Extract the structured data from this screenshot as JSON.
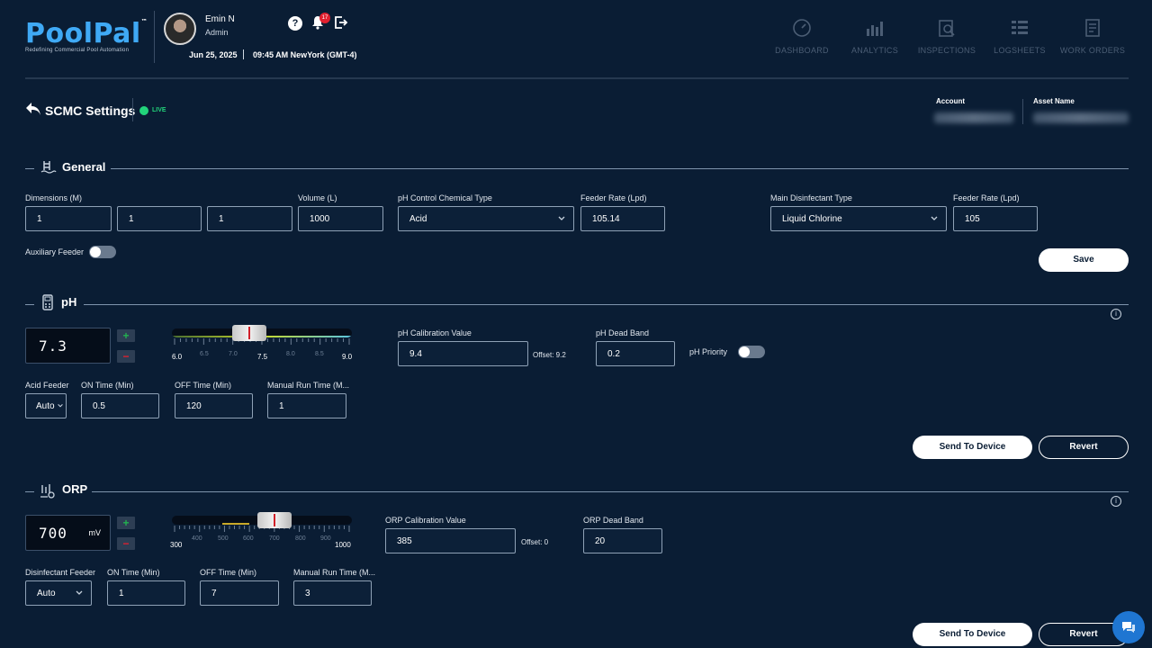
{
  "brand": {
    "name": "PoolPal",
    "tm": "™",
    "tagline": "Redefining Commercial Pool Automation"
  },
  "user": {
    "name": "Emin N",
    "role": "Admin",
    "date": "Jun 25, 2025",
    "time": "09:45 AM NewYork (GMT-4)",
    "notifications": "17"
  },
  "nav": [
    {
      "label": "DASHBOARD",
      "icon": "gauge-icon"
    },
    {
      "label": "ANALYTICS",
      "icon": "analytics-icon"
    },
    {
      "label": "INSPECTIONS",
      "icon": "inspections-icon"
    },
    {
      "label": "LOGSHEETS",
      "icon": "logsheets-icon"
    },
    {
      "label": "WORK ORDERS",
      "icon": "work-orders-icon"
    }
  ],
  "page": {
    "title": "SCMC Settings",
    "status": "LIVE",
    "account_label": "Account",
    "asset_label": "Asset Name"
  },
  "general": {
    "title": "General",
    "dimensions_label": "Dimensions (M)",
    "dims": [
      "1",
      "1",
      "1"
    ],
    "volume_label": "Volume (L)",
    "volume": "1000",
    "ph_chem_label": "pH Control Chemical Type",
    "ph_chem": "Acid",
    "feeder_rate_label": "Feeder Rate (Lpd)",
    "feeder_rate": "105.14",
    "disinfectant_label": "Main Disinfectant Type",
    "disinfectant": "Liquid Chlorine",
    "feeder_rate2_label": "Feeder Rate (Lpd)",
    "feeder_rate2": "105",
    "aux_label": "Auxiliary Feeder",
    "save": "Save"
  },
  "ph": {
    "title": "pH",
    "reading": "7.3",
    "scale_min": "6.0",
    "scale_max": "9.0",
    "ticks": [
      "6.5",
      "7.0",
      "7.5",
      "8.0",
      "8.5"
    ],
    "calib_label": "pH Calibration Value",
    "calib": "9.4",
    "offset": "Offset: 9.2",
    "deadband_label": "pH Dead Band",
    "deadband": "0.2",
    "priority_label": "pH Priority",
    "feeder_label": "Acid Feeder",
    "feeder": "Auto",
    "on_label": "ON Time (Min)",
    "on": "0.5",
    "off_label": "OFF Time (Min)",
    "off": "120",
    "manual_label": "Manual Run Time (M...",
    "manual": "1",
    "send": "Send To Device",
    "revert": "Revert"
  },
  "orp": {
    "title": "ORP",
    "reading": "700",
    "unit": "mV",
    "scale_min": "300",
    "scale_max": "1000",
    "ticks": [
      "400",
      "500",
      "600",
      "700",
      "800",
      "900"
    ],
    "calib_label": "ORP Calibration Value",
    "calib": "385",
    "offset": "Offset: 0",
    "deadband_label": "ORP Dead Band",
    "deadband": "20",
    "feeder_label": "Disinfectant Feeder",
    "feeder": "Auto",
    "on_label": "ON Time (Min)",
    "on": "1",
    "off_label": "OFF Time (Min)",
    "off": "7",
    "manual_label": "Manual Run Time (M...",
    "manual": "3",
    "send": "Send To Device",
    "revert": "Revert"
  },
  "colors": {
    "background": "#0a1d34",
    "brand": "#3fa9f5",
    "live": "#22d47b",
    "alert": "#e0202f"
  }
}
